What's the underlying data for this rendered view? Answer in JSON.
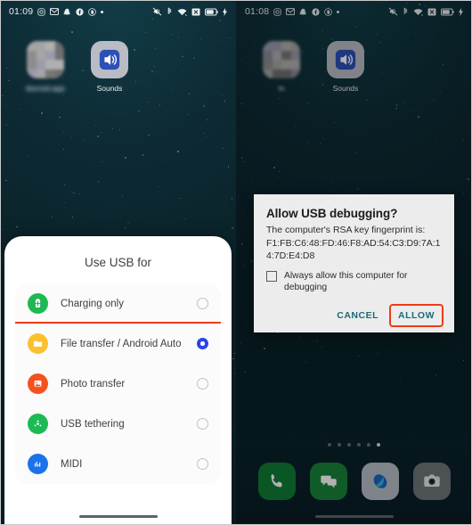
{
  "left_phone": {
    "statusbar": {
      "time": "01:09",
      "notification_icons": [
        "instagram-icon",
        "mail-icon",
        "snapchat-icon",
        "facebook-icon",
        "app-badge-icon",
        "dot-icon"
      ],
      "system_icons": [
        "mute-icon",
        "bluetooth-icon",
        "wifi-icon",
        "no-sim-icon",
        "battery-icon",
        "charging-bolt-icon"
      ]
    },
    "home_apps": [
      {
        "label": "blurred-app",
        "icon": "blurred-app-icon",
        "blurred": true
      },
      {
        "label": "Sounds",
        "icon": "sounds-speaker-icon",
        "blurred": false
      }
    ],
    "sheet": {
      "title": "Use USB for",
      "options": [
        {
          "label": "Charging only",
          "icon": "battery-charge-icon",
          "color": "#1db954",
          "selected": false,
          "highlighted": false
        },
        {
          "label": "File transfer / Android Auto",
          "icon": "folder-icon",
          "color": "#fbc02d",
          "selected": true,
          "highlighted": true
        },
        {
          "label": "Photo transfer",
          "icon": "photo-icon",
          "color": "#f4511e",
          "selected": false,
          "highlighted": false
        },
        {
          "label": "USB tethering",
          "icon": "tethering-icon",
          "color": "#1db954",
          "selected": false,
          "highlighted": false
        },
        {
          "label": "MIDI",
          "icon": "midi-bars-icon",
          "color": "#1a73e8",
          "selected": false,
          "highlighted": false
        }
      ],
      "highlight_color": "#ef3b18",
      "selected_radio_color": "#2945e8"
    }
  },
  "right_phone": {
    "statusbar": {
      "time": "01:08",
      "notification_icons": [
        "instagram-icon",
        "mail-icon",
        "snapchat-icon",
        "facebook-icon",
        "app-badge-icon",
        "dot-icon"
      ],
      "system_icons": [
        "mute-icon",
        "bluetooth-icon",
        "wifi-icon",
        "no-sim-icon",
        "battery-icon",
        "charging-bolt-icon"
      ]
    },
    "home_apps": [
      {
        "label": "In",
        "icon": "blurred-app-icon",
        "blurred": true
      },
      {
        "label": "Sounds",
        "icon": "sounds-speaker-icon",
        "blurred": false
      }
    ],
    "dialog": {
      "title": "Allow USB debugging?",
      "message": "The computer's RSA key fingerprint is:",
      "fingerprint": "F1:FB:C6:48:FD:46:F8:AD:54:C3:D9:7A:14:7D:E4:D8",
      "checkbox_label": "Always allow this computer for debugging",
      "checkbox_checked": false,
      "cancel_label": "CANCEL",
      "allow_label": "ALLOW",
      "allow_highlighted": true,
      "button_color": "#1b6b77",
      "highlight_color": "#ef3b18"
    },
    "page_dots": {
      "count": 6,
      "active_index": 5
    },
    "dock": [
      {
        "name": "phone-app",
        "icon": "phone-icon",
        "color": "#0f7b34"
      },
      {
        "name": "messages-app",
        "icon": "message-icon",
        "color": "#17833a"
      },
      {
        "name": "browser-app",
        "icon": "globe-icon",
        "color": "#b6bec6"
      },
      {
        "name": "camera-app",
        "icon": "camera-icon",
        "color": "#6d7479"
      }
    ]
  }
}
